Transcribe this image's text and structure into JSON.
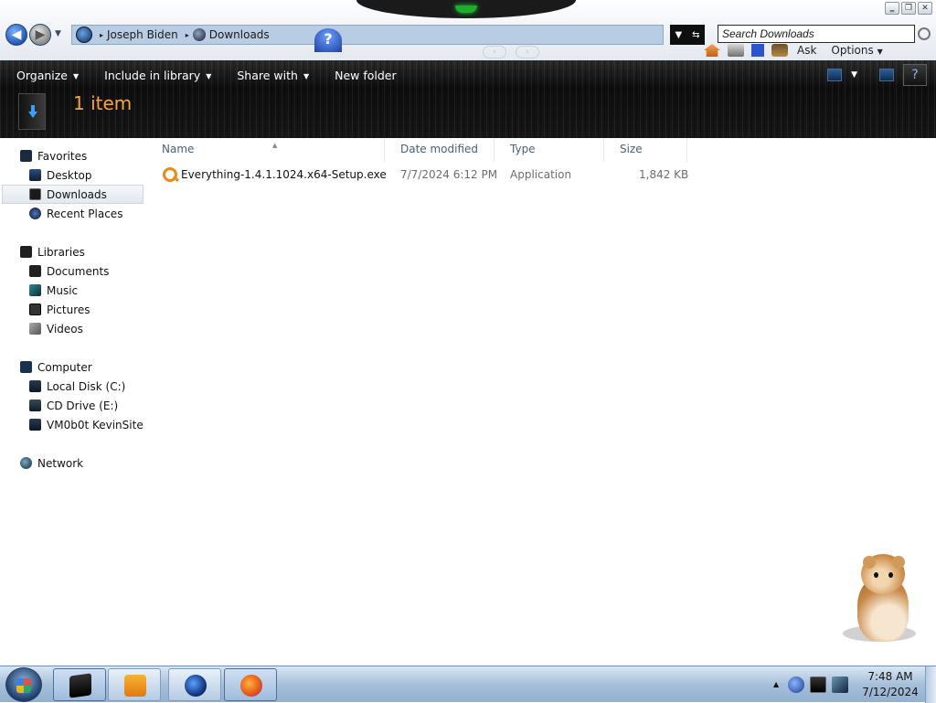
{
  "window": {
    "minimize": "‗",
    "maximize": "❐",
    "close": "✕"
  },
  "address": {
    "segments": [
      "Joseph Biden",
      "Downloads"
    ],
    "help": "?"
  },
  "search": {
    "placeholder": "Search Downloads"
  },
  "ie_tools": {
    "ask_label": "Ask",
    "options_label": "Options"
  },
  "toolbar": {
    "organize": "Organize",
    "include_in_library": "Include in library",
    "share_with": "Share with",
    "new_folder": "New folder"
  },
  "details": {
    "item_count": "1 item"
  },
  "nav": {
    "favorites": {
      "label": "Favorites",
      "items": [
        "Desktop",
        "Downloads",
        "Recent Places"
      ]
    },
    "libraries": {
      "label": "Libraries",
      "items": [
        "Documents",
        "Music",
        "Pictures",
        "Videos"
      ]
    },
    "computer": {
      "label": "Computer",
      "items": [
        "Local Disk (C:)",
        "CD Drive (E:)",
        "VM0b0t KevinSite"
      ]
    },
    "network": {
      "label": "Network"
    },
    "selected": "Downloads"
  },
  "columns": [
    "Name",
    "Date modified",
    "Type",
    "Size"
  ],
  "files": [
    {
      "name": "Everything-1.4.1.1024.x64-Setup.exe",
      "date_modified": "7/7/2024 6:12 PM",
      "type": "Application",
      "size": "1,842 KB"
    }
  ],
  "taskbar": {
    "clock_time": "7:48 AM",
    "clock_date": "7/12/2024",
    "apps": [
      "Windows Explorer",
      "Media Player",
      "Internet Explorer",
      "Firefox"
    ]
  },
  "colors": {
    "item_count_accent": "#f6a540",
    "command_bar": "#111111",
    "taskbar": "#a7c0da"
  }
}
